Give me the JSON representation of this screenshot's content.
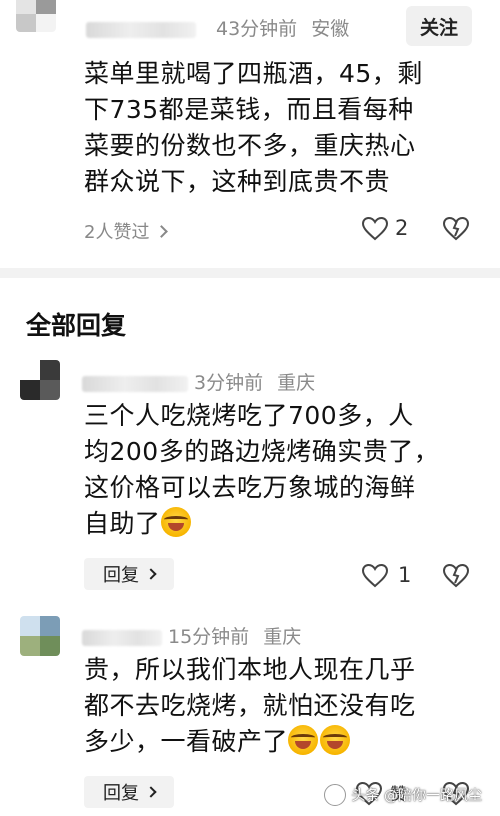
{
  "comment": {
    "time": "43分钟前",
    "location": "安徽",
    "follow_label": "关注",
    "lines": [
      "菜单里就喝了四瓶酒，45，剩",
      "下735都是菜钱，而且看每种",
      "菜要的份数也不多，重庆热心",
      "群众说下，这种到底贵不贵"
    ],
    "likes_text": "2人赞过",
    "like_count": "2"
  },
  "section_title": "全部回复",
  "replies": [
    {
      "time": "3分钟前",
      "location": "重庆",
      "lines": [
        "三个人吃烧烤吃了700多，人",
        "均200多的路边烧烤确实贵了，",
        "这价格可以去吃万象城的海鲜",
        "自助了"
      ],
      "reply_label": "回复",
      "like_count": "1"
    },
    {
      "time": "15分钟前",
      "location": "重庆",
      "lines": [
        "贵，所以我们本地人现在几乎",
        "都不去吃烧烤，就怕还没有吃",
        "多少，一看破产了"
      ],
      "reply_label": "回复",
      "like_count": "赞"
    }
  ],
  "watermark": "头条 @陪你一路风尘",
  "colors": {
    "meta": "#8a8a8a",
    "text": "#111111",
    "button_bg": "#f0f0f0"
  }
}
